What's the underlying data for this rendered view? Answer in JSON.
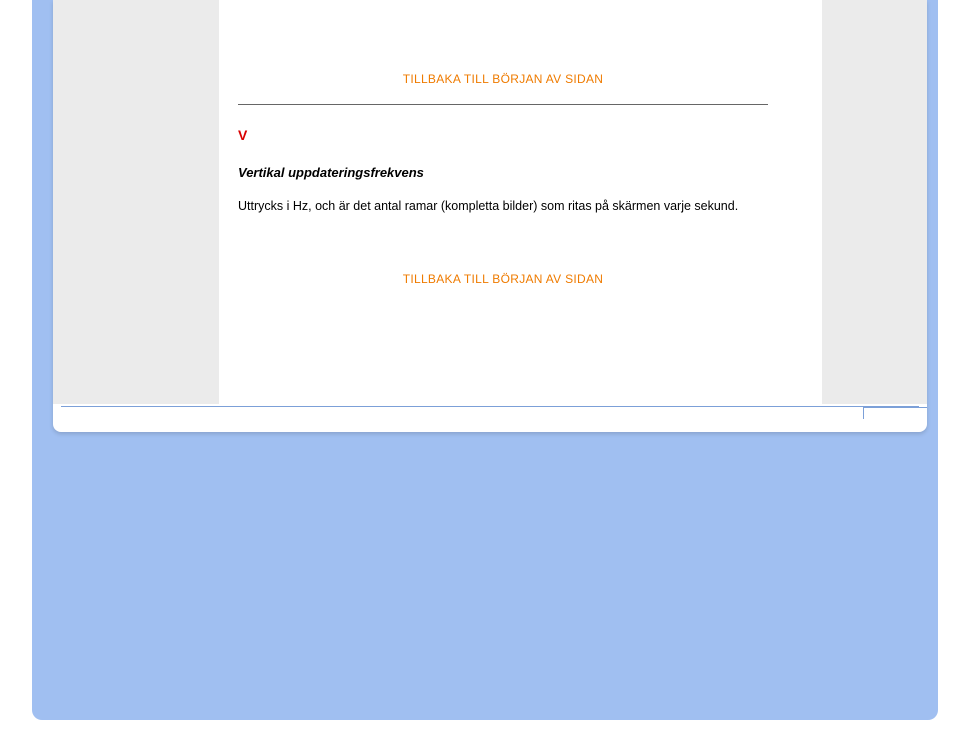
{
  "links": {
    "back_to_top": "TILLBAKA TILL BÖRJAN AV SIDAN"
  },
  "section": {
    "letter": "V",
    "term": "Vertikal uppdateringsfrekvens",
    "definition": "Uttrycks i Hz, och är det antal ramar (kompletta bilder) som ritas på skärmen varje sekund."
  }
}
